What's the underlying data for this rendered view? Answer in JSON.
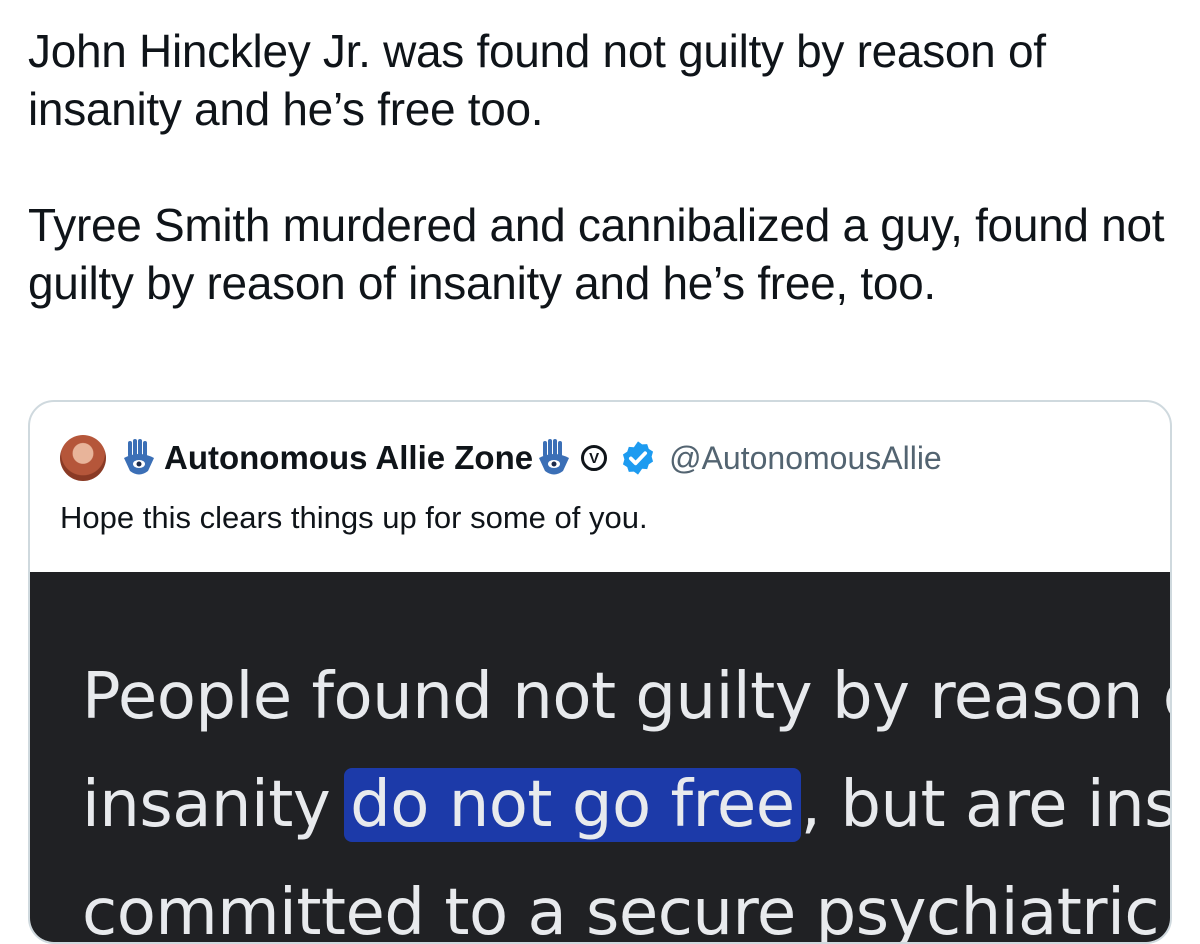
{
  "tweet": {
    "paragraphs": [
      "John Hinckley Jr. was found not guilty by reason of insanity and he’s free too.",
      "Tyree Smith murdered and cannibalized a guy, found not guilty by reason of insanity and he’s free, too."
    ]
  },
  "quote": {
    "display_name": "Autonomous Allie Zone",
    "handle": "@AutonomousAllie",
    "text": "Hope this clears things up for some of you.",
    "icons": [
      "avatar",
      "hamsa-icon",
      "hamsa-icon",
      "circle-v-icon",
      "verified-badge-icon"
    ],
    "media": {
      "line1": "People found not guilty by reason of",
      "line2_before": "insanity ",
      "line2_highlight": "do not go free",
      "line2_after": ", but are instead",
      "line3": "committed to a secure psychiatric"
    }
  },
  "colors": {
    "text": "#0f1419",
    "secondary": "#536471",
    "verified": "#1d9bf0",
    "media_bg": "#202124",
    "highlight": "#1c3aa9"
  }
}
